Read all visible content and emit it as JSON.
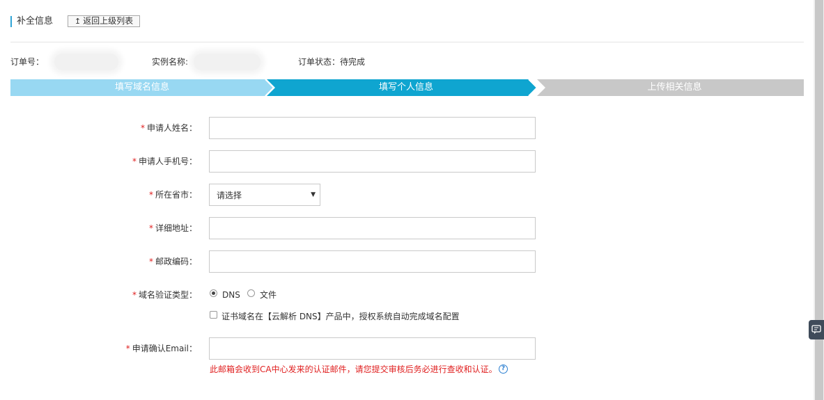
{
  "header": {
    "title": "补全信息",
    "back_button": "返回上级列表",
    "back_icon": "↥"
  },
  "info": {
    "order_no_label": "订单号：",
    "instance_label": "实例名称:",
    "status_label": "订单状态：",
    "status_value": "待完成"
  },
  "steps": [
    {
      "label": "填写域名信息",
      "state": "done",
      "color": "#98d8f2"
    },
    {
      "label": "填写个人信息",
      "state": "current",
      "color": "#0fa5d0"
    },
    {
      "label": "上传相关信息",
      "state": "pending",
      "color": "#c8c8c8"
    }
  ],
  "form": {
    "required_mark": "*",
    "name_label": "申请人姓名：",
    "name_value": "",
    "phone_label": "申请人手机号：",
    "phone_value": "",
    "city_label": "所在省市：",
    "city_select": "请选择",
    "address_label": "详细地址：",
    "address_value": "",
    "zip_label": "邮政编码：",
    "zip_value": "",
    "verify_label": "域名验证类型：",
    "verify_options": [
      "DNS",
      "文件"
    ],
    "verify_selected": "DNS",
    "auto_dns_label": "证书域名在【云解析 DNS】产品中，授权系统自动完成域名配置",
    "auto_dns_checked": false,
    "email_label": "申请确认Email：",
    "email_value": "",
    "email_note": "此邮箱会收到CA中心发来的认证邮件，请您提交审核后务必进行查收和认证。",
    "help_icon": "?"
  },
  "colors": {
    "required": "#e02020",
    "accent": "#0fa5d0"
  }
}
